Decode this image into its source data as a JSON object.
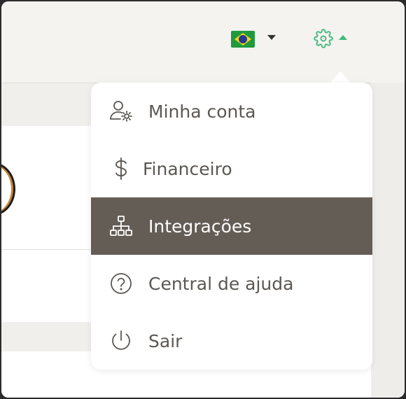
{
  "header": {
    "language_flag_icon": "brazil-flag-icon",
    "language_caret_icon": "caret-down-icon",
    "settings_icon": "gear-icon",
    "settings_caret_icon": "caret-up-icon",
    "accent_color": "#3fb87a"
  },
  "menu": {
    "selected_bg": "#645d56",
    "items": [
      {
        "label": "Minha conta",
        "icon": "user-settings-icon"
      },
      {
        "label": "Financeiro",
        "icon": "dollar-icon"
      },
      {
        "label": "Integrações",
        "icon": "sitemap-icon",
        "selected": true
      },
      {
        "label": "Central de ajuda",
        "icon": "question-circle-icon"
      },
      {
        "label": "Sair",
        "icon": "power-icon"
      }
    ]
  }
}
